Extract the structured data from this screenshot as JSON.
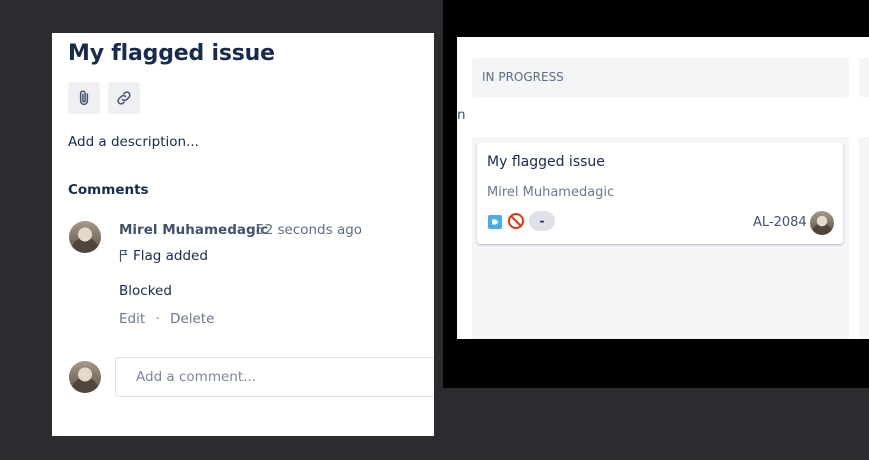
{
  "issue_panel": {
    "title": "My flagged issue",
    "description_placeholder": "Add a description...",
    "comments_heading": "Comments",
    "comment": {
      "author": "Mirel Muhamedagic",
      "time": "52 seconds ago",
      "flag_text": "Flag added",
      "body": "Blocked",
      "edit_label": "Edit",
      "separator": "·",
      "delete_label": "Delete"
    },
    "add_comment_placeholder": "Add a comment..."
  },
  "board": {
    "stray_text": "n",
    "column": {
      "header": "IN PROGRESS",
      "card": {
        "title": "My flagged issue",
        "assignee": "Mirel Muhamedagic",
        "estimate": "-",
        "key": "AL-2084"
      }
    }
  },
  "colors": {
    "accent_text": "#172b4d",
    "secondary_text": "#5e6c84",
    "column_bg": "#f4f5f7",
    "story_icon": "#4bade8",
    "blocked_icon": "#de350b"
  },
  "icons": {
    "attach": "paperclip-icon",
    "link": "link-icon",
    "flag": "flag-icon",
    "issue_type": "task-icon",
    "blocked": "blocked-icon"
  }
}
